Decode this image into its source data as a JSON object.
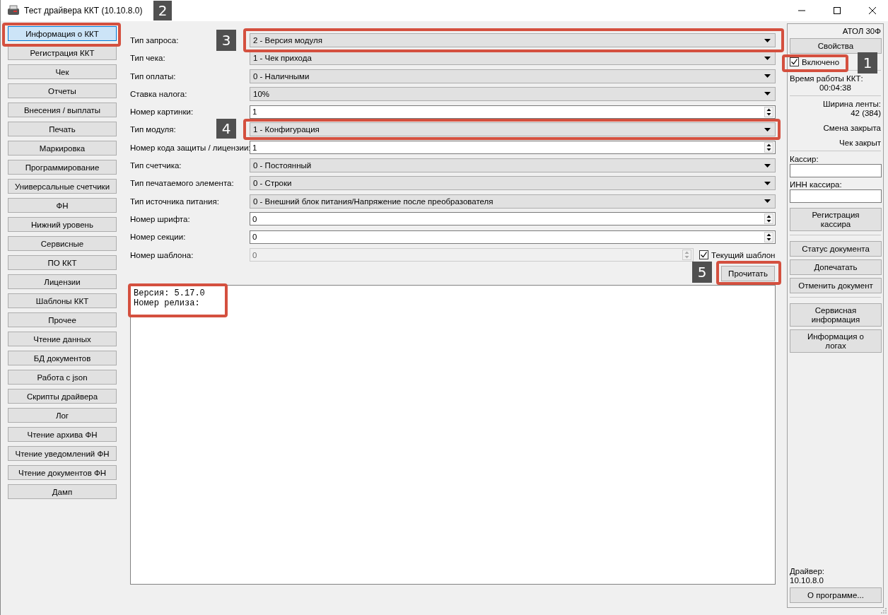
{
  "window": {
    "title": "Тест драйвера ККТ (10.10.8.0)"
  },
  "sidebar": {
    "items": [
      {
        "label": "Информация о ККТ",
        "selected": true
      },
      {
        "label": "Регистрация ККТ",
        "selected": false
      },
      {
        "label": "Чек",
        "selected": false
      },
      {
        "label": "Отчеты",
        "selected": false
      },
      {
        "label": "Внесения / выплаты",
        "selected": false
      },
      {
        "label": "Печать",
        "selected": false
      },
      {
        "label": "Маркировка",
        "selected": false
      },
      {
        "label": "Программирование",
        "selected": false
      },
      {
        "label": "Универсальные счетчики",
        "selected": false
      },
      {
        "label": "ФН",
        "selected": false
      },
      {
        "label": "Нижний уровень",
        "selected": false
      },
      {
        "label": "Сервисные",
        "selected": false
      },
      {
        "label": "ПО ККТ",
        "selected": false
      },
      {
        "label": "Лицензии",
        "selected": false
      },
      {
        "label": "Шаблоны ККТ",
        "selected": false
      },
      {
        "label": "Прочее",
        "selected": false
      },
      {
        "label": "Чтение данных",
        "selected": false
      },
      {
        "label": "БД документов",
        "selected": false
      },
      {
        "label": "Работа с json",
        "selected": false
      },
      {
        "label": "Скрипты драйвера",
        "selected": false
      },
      {
        "label": "Лог",
        "selected": false
      },
      {
        "label": "Чтение архива ФН",
        "selected": false
      },
      {
        "label": "Чтение уведомлений ФН",
        "selected": false
      },
      {
        "label": "Чтение документов ФН",
        "selected": false
      },
      {
        "label": "Дамп",
        "selected": false
      }
    ]
  },
  "form": {
    "fields": [
      {
        "label": "Тип запроса:",
        "kind": "combo",
        "value": "2 - Версия модуля"
      },
      {
        "label": "Тип чека:",
        "kind": "combo",
        "value": "1 - Чек прихода"
      },
      {
        "label": "Тип оплаты:",
        "kind": "combo",
        "value": "0 - Наличными"
      },
      {
        "label": "Ставка налога:",
        "kind": "combo",
        "value": "10%"
      },
      {
        "label": "Номер картинки:",
        "kind": "spin",
        "value": "1",
        "disabled": false
      },
      {
        "label": "Тип модуля:",
        "kind": "combo",
        "value": "1 - Конфигурация"
      },
      {
        "label": "Номер кода защиты / лицензии:",
        "kind": "spin",
        "value": "1",
        "disabled": false
      },
      {
        "label": "Тип счетчика:",
        "kind": "combo",
        "value": "0 - Постоянный"
      },
      {
        "label": "Тип печатаемого элемента:",
        "kind": "combo",
        "value": "0 - Строки"
      },
      {
        "label": "Тип источника питания:",
        "kind": "combo",
        "value": "0 - Внешний блок питания/Напряжение после преобразователя"
      },
      {
        "label": "Номер шрифта:",
        "kind": "spin",
        "value": "0",
        "disabled": false
      },
      {
        "label": "Номер секции:",
        "kind": "spin",
        "value": "0",
        "disabled": false
      },
      {
        "label": "Номер шаблона:",
        "kind": "spin",
        "value": "0",
        "disabled": true,
        "checkbox": {
          "label": "Текущий шаблон",
          "checked": true
        }
      }
    ],
    "read_button": "Прочитать",
    "output": {
      "lines": [
        "Версия: 5.17.0",
        "Номер релиза:"
      ]
    }
  },
  "right_panel": {
    "device": "АТОЛ 30Ф",
    "properties_button": "Свойства",
    "enabled": {
      "label": "Включено",
      "checked": true
    },
    "uptime_label": "Время работы ККТ:",
    "uptime": "00:04:38",
    "tape_width_label": "Ширина ленты:",
    "tape_width": "42 (384)",
    "shift_status": "Смена закрыта",
    "receipt_status": "Чек закрыт",
    "cashier_label": "Кассир:",
    "cashier_inn_label": "ИНН кассира:",
    "cashier_button": "Регистрация кассира",
    "document_buttons": [
      "Статус документа",
      "Допечатать",
      "Отменить документ"
    ],
    "info_buttons": [
      "Сервисная информация",
      "Информация о логах"
    ],
    "driver_label": "Драйвер:",
    "driver_version": "10.10.8.0",
    "about_button": "О программе..."
  },
  "callouts": [
    {
      "number": "1"
    },
    {
      "number": "2"
    },
    {
      "number": "3"
    },
    {
      "number": "4"
    },
    {
      "number": "5"
    }
  ]
}
